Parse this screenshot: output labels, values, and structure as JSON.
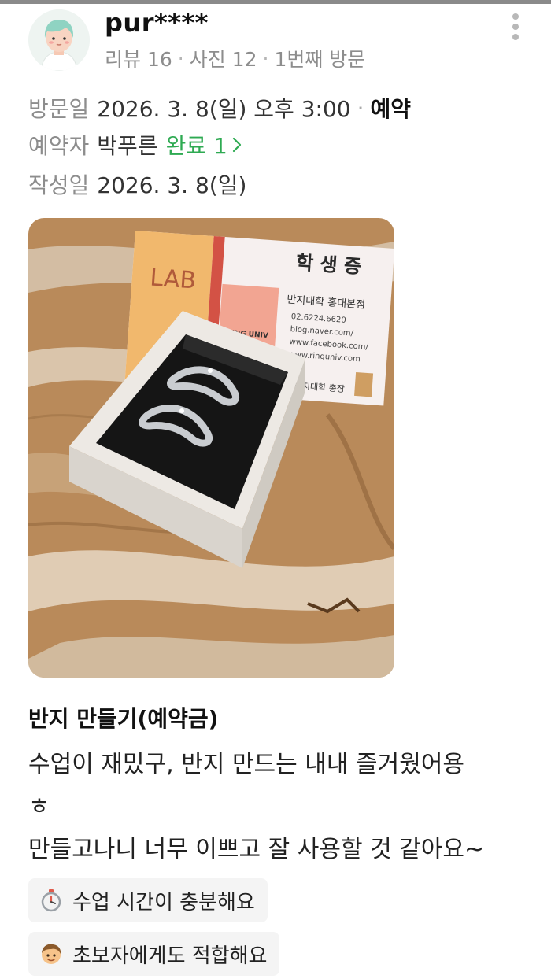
{
  "user": {
    "name": "pur****",
    "reviews": "리뷰 16",
    "photos": "사진 12",
    "visit_count": "1번째 방문"
  },
  "visit": {
    "label": "방문일",
    "date": "2026. 3. 8(일) 오후 3:00",
    "type": "예약"
  },
  "reserver": {
    "label": "예약자",
    "name": "박푸른",
    "status": "완료 1"
  },
  "written": {
    "label": "작성일",
    "date": "2026. 3. 8(일)"
  },
  "photo": {
    "card_title": "학 생 증",
    "card_school": "반지대학 홍대본점",
    "card_phone": "02.6224.6620",
    "card_blog": "blog.naver.com/",
    "card_facebook": "www.facebook.com/",
    "card_site": "www.ringuniv.com",
    "card_univ": "RING UNIV",
    "card_logo": "LAB",
    "card_footer": "반지대학 총장"
  },
  "review": {
    "title": "반지 만들기(예약금)",
    "lines": [
      "수업이 재밌구, 반지 만드는 내내 즐거웠어용",
      "ㅎ",
      "만들고나니 너무 이쁘고 잘 사용할 것 같아요~"
    ]
  },
  "tags": [
    {
      "icon": "stopwatch-icon",
      "label": "수업 시간이 충분해요"
    },
    {
      "icon": "boy-face-icon",
      "label": "초보자에게도 적합해요"
    }
  ],
  "colors": {
    "accent_green": "#2eaa52",
    "muted_gray": "#8d8d8d",
    "tag_bg": "#f4f4f4"
  }
}
